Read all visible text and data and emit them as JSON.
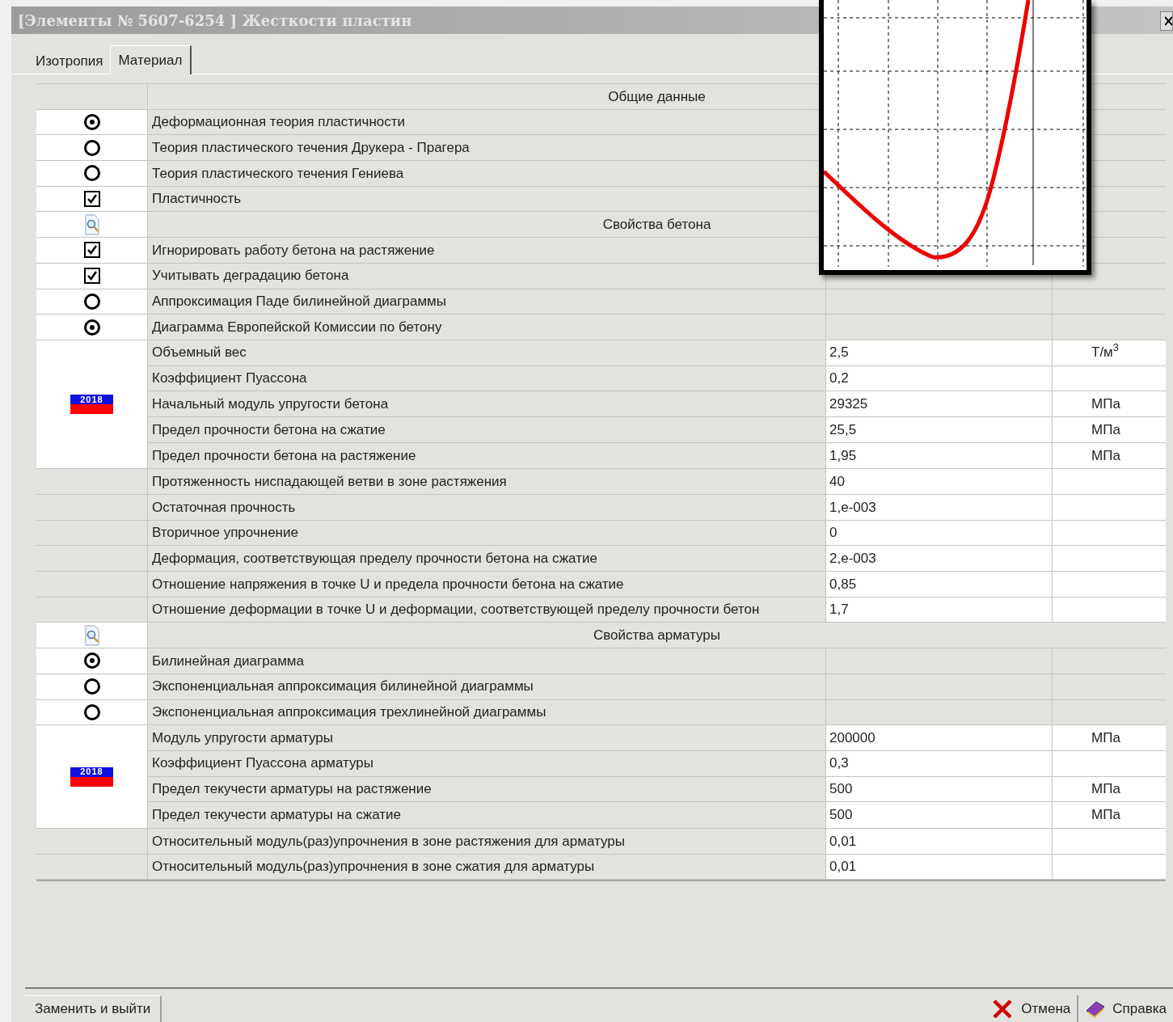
{
  "window": {
    "title": "[Элементы № 5607-6254 ] Жесткости пластин"
  },
  "tabs": [
    {
      "label": "Изотропия",
      "selected": false
    },
    {
      "label": "Материал",
      "selected": true
    }
  ],
  "sections": [
    {
      "title": "Общие данные",
      "magnifier": false,
      "items": [
        {
          "kind": "radio",
          "label": "Деформационная теория пластичности",
          "selected": true
        },
        {
          "kind": "radio",
          "label": "Теория пластического течения Друкера - Прагера",
          "selected": false
        },
        {
          "kind": "radio",
          "label": "Теория пластического течения Гениева",
          "selected": false
        },
        {
          "kind": "checkbox",
          "label": "Пластичность",
          "checked": true
        }
      ]
    },
    {
      "title": "Свойства бетона",
      "magnifier": true,
      "items": [
        {
          "kind": "checkbox",
          "label": "Игнорировать работу бетона на растяжение",
          "checked": true
        },
        {
          "kind": "checkbox",
          "label": "Учитывать деградацию бетона",
          "checked": true
        },
        {
          "kind": "radio",
          "label": "Аппроксимация Паде билинейной диаграммы",
          "selected": false
        },
        {
          "kind": "radio",
          "label": "Диаграмма Европейской Комиссии по бетону",
          "selected": true
        },
        {
          "kind": "group",
          "badge": "2018",
          "rows": [
            {
              "label": "Объемный вес",
              "value": "2,5",
              "unit": "Т/м$^{3}$"
            },
            {
              "label": "Коэффициент Пуассона",
              "value": "0,2"
            },
            {
              "label": "Начальный модуль упругости бетона",
              "value": "29325",
              "unit": "МПа"
            },
            {
              "label": "Предел прочности бетона на сжатие",
              "value": "25,5",
              "unit": "МПа"
            },
            {
              "label": "Предел прочности бетона на растяжение",
              "value": "1,95",
              "unit": "МПа"
            }
          ]
        },
        {
          "kind": "param",
          "label": "Протяженность ниспадающей ветви в зоне растяжения",
          "value": "40"
        },
        {
          "kind": "param",
          "label": "Остаточная прочность",
          "value": "1,e-003"
        },
        {
          "kind": "param",
          "label": "Вторичное упрочнение",
          "value": "0"
        },
        {
          "kind": "param",
          "label": "Деформация, соответствующая пределу прочности бетона на сжатие",
          "value": "2,e-003"
        },
        {
          "kind": "param",
          "label": "Отношение напряжения в точке U и предела прочности бетона на сжатие",
          "value": "0,85"
        },
        {
          "kind": "param",
          "label": "Отношение деформации в точке U и деформации, соответствующей пределу прочности бетон",
          "value": "1,7"
        }
      ]
    },
    {
      "title": "Свойства арматуры",
      "magnifier": true,
      "items": [
        {
          "kind": "radio",
          "label": "Билинейная диаграмма",
          "selected": true
        },
        {
          "kind": "radio",
          "label": "Экспоненциальная аппроксимация билинейной диаграммы",
          "selected": false
        },
        {
          "kind": "radio",
          "label": "Экспоненциальная аппроксимация трехлинейной диаграммы",
          "selected": false
        },
        {
          "kind": "group",
          "badge": "2018",
          "rows": [
            {
              "label": "Модуль упругости арматуры",
              "value": "200000",
              "unit": "МПа"
            },
            {
              "label": "Коэффициент Пуассона арматуры",
              "value": "0,3"
            },
            {
              "label": "Предел текучести арматуры на растяжение",
              "value": "500",
              "unit": "МПа"
            },
            {
              "label": "Предел текучести арматуры на сжатие",
              "value": "500",
              "unit": "МПа"
            }
          ]
        },
        {
          "kind": "param",
          "label": "Относительный модуль(раз)упрочнения в зоне растяжения для арматуры",
          "value": "0,01"
        },
        {
          "kind": "param",
          "label": "Относительный модуль(раз)упрочнения в зоне сжатия для арматуры",
          "value": "0,01"
        }
      ]
    }
  ],
  "buttons": {
    "apply": "Заменить и выйти",
    "cancel": "Отмена",
    "help": "Справка"
  }
}
